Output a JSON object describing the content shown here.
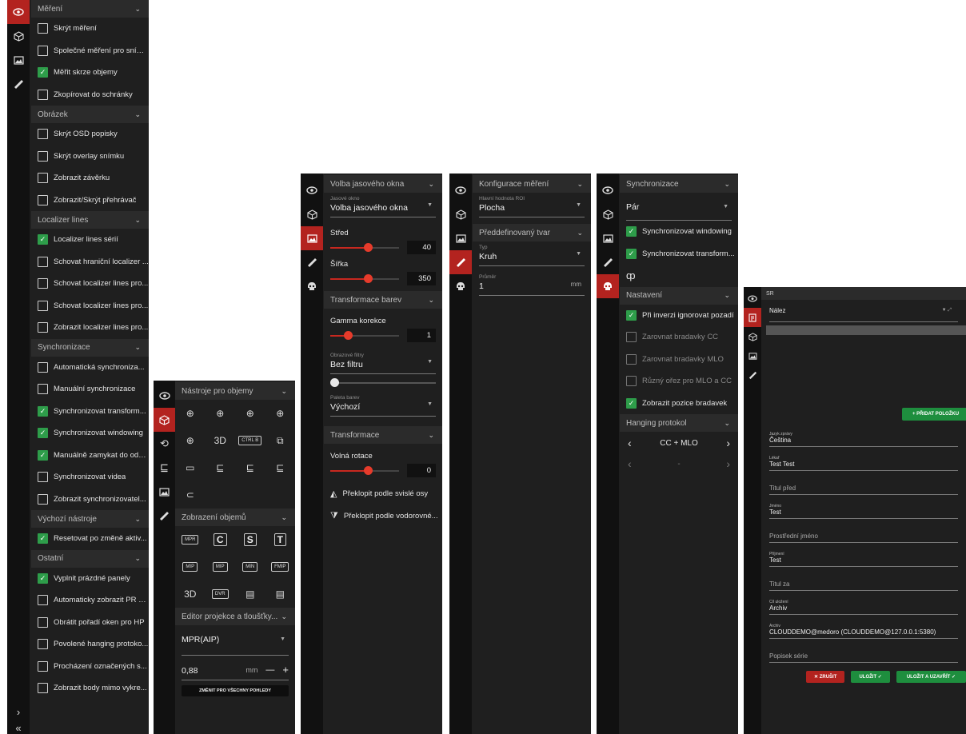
{
  "panel1": {
    "rail_icons": [
      "eye-icon",
      "cube-icon",
      "image-icon",
      "ruler-icon"
    ],
    "rail_bottom": [
      "›",
      "«"
    ],
    "sections": [
      {
        "title": "Měření",
        "items": [
          {
            "label": "Skrýt měření",
            "checked": false
          },
          {
            "label": "Společné měření pro sním...",
            "checked": false
          },
          {
            "label": "Měřit skrze objemy",
            "checked": true
          },
          {
            "label": "Zkopírovat do schránky",
            "checked": false
          }
        ]
      },
      {
        "title": "Obrázek",
        "items": [
          {
            "label": "Skrýt OSD popisky",
            "checked": false
          },
          {
            "label": "Skrýt overlay snímku",
            "checked": false
          },
          {
            "label": "Zobrazit závěrku",
            "checked": false
          },
          {
            "label": "Zobrazit/Skrýt přehrávač",
            "checked": false
          }
        ]
      },
      {
        "title": "Localizer lines",
        "items": [
          {
            "label": "Localizer lines sérií",
            "checked": true
          },
          {
            "label": "Schovat hraniční localizer ...",
            "checked": false
          },
          {
            "label": "Schovat localizer lines pro...",
            "checked": false
          },
          {
            "label": "Schovat localizer lines pro...",
            "checked": false
          },
          {
            "label": "Zobrazit localizer lines pro...",
            "checked": false
          }
        ]
      },
      {
        "title": "Synchronizace",
        "items": [
          {
            "label": "Automatická synchroniza...",
            "checked": false
          },
          {
            "label": "Manuální synchronizace",
            "checked": false
          },
          {
            "label": "Synchronizovat transform...",
            "checked": true
          },
          {
            "label": "Synchronizovat windowing",
            "checked": true
          },
          {
            "label": "Manuálně zamykat do odd...",
            "checked": true
          },
          {
            "label": "Synchronizovat videa",
            "checked": false
          },
          {
            "label": "Zobrazit synchronizovatel...",
            "checked": false
          }
        ]
      },
      {
        "title": "Výchozí nástroje",
        "items": [
          {
            "label": "Resetovat po změně aktiv...",
            "checked": true
          }
        ]
      },
      {
        "title": "Ostatní",
        "items": [
          {
            "label": "Vyplnit prázdné panely",
            "checked": true
          },
          {
            "label": "Automaticky zobrazit PR p...",
            "checked": false
          },
          {
            "label": "Obrátit pořadí oken pro HP",
            "checked": false
          },
          {
            "label": "Povolené hanging protoko...",
            "checked": false
          },
          {
            "label": "Procházení označených s...",
            "checked": false
          },
          {
            "label": "Zobrazit body mimo vykre...",
            "checked": false
          }
        ]
      }
    ]
  },
  "panel2": {
    "rail_icons": [
      "eye-icon",
      "cube-icon",
      "rotate-icon",
      "mpr-icon",
      "image-icon",
      "ruler-icon"
    ],
    "section1": "Nástroje pro objemy",
    "tools1": [
      "⊕",
      "⊕",
      "⊕",
      "⊕",
      "⊕",
      "3D",
      "CTRL B",
      "⧉",
      "▭",
      "⊑",
      "⊑",
      "⊑",
      "⊂"
    ],
    "section2": "Zobrazení objemů",
    "tools2": [
      "MPR",
      "C",
      "S",
      "T",
      "MIP",
      "MIP",
      "MIN",
      "FMIP",
      "3D",
      "DVR",
      "▤",
      "▤"
    ],
    "section3": "Editor projekce a tloušťky...",
    "mode": "MPR(AIP)",
    "thickness": "0,88",
    "unit": "mm",
    "minus": "—",
    "plus": "+",
    "apply_all": "ZMĚNIT PRO VŠECHNY POHLEDY"
  },
  "panel3": {
    "rail_icons": [
      "eye-icon",
      "cube-icon",
      "image-icon",
      "ruler-icon",
      "skull-icon"
    ],
    "section1": "Volba jasového okna",
    "window_label": "Jasové okno",
    "window_value": "Volba jasového okna",
    "center_label": "Střed",
    "center_value": "40",
    "center_level": 0.55,
    "width_label": "Šířka",
    "width_value": "350",
    "width_level": 0.55,
    "section2": "Transformace barev",
    "gamma_label": "Gamma korekce",
    "gamma_value": "1",
    "gamma_level": 0.25,
    "filter_label": "Obrazové filtry",
    "filter_value": "Bez filtru",
    "palette_label": "Paleta barev",
    "palette_value": "Výchozí",
    "section3": "Transformace",
    "rotation_label": "Volná rotace",
    "rotation_value": "0",
    "rotation_level": 0.55,
    "flip_v": "Překlopit podle svislé osy",
    "flip_h": "Překlopit podle vodorovné..."
  },
  "panel4": {
    "rail_icons": [
      "eye-icon",
      "cube-icon",
      "image-icon",
      "ruler-icon",
      "skull-icon"
    ],
    "section1": "Konfigurace měření",
    "roi_label": "Hlavní hodnota ROI",
    "roi_value": "Plocha",
    "section2": "Předdefinovaný tvar",
    "type_label": "Typ",
    "type_value": "Kruh",
    "diameter_label": "Průměr",
    "diameter_value": "1",
    "diameter_unit": "mm"
  },
  "panel5": {
    "rail_icons": [
      "eye-icon",
      "cube-icon",
      "image-icon",
      "ruler-icon",
      "skull-icon"
    ],
    "section1": "Synchronizace",
    "pair_value": "Pár",
    "sync_items": [
      {
        "label": "Synchronizovat windowing",
        "checked": true
      },
      {
        "label": "Synchronizovat transform...",
        "checked": true
      }
    ],
    "section2": "Nastavení",
    "settings": [
      {
        "label": "Při inverzi ignorovat pozadí",
        "checked": true,
        "disabled": false
      },
      {
        "label": "Zarovnat bradavky CC",
        "checked": false,
        "disabled": true
      },
      {
        "label": "Zarovnat bradavky MLO",
        "checked": false,
        "disabled": true
      },
      {
        "label": "Různý ořez pro MLO a CC",
        "checked": false,
        "disabled": true
      },
      {
        "label": "Zobrazit pozice bradavek",
        "checked": true,
        "disabled": false
      }
    ],
    "section3": "Hanging protokol",
    "protocol_value": "CC + MLO",
    "protocol_value2": "-"
  },
  "panel6": {
    "rail_icons": [
      "eye-icon",
      "report-icon",
      "cube-icon",
      "image-icon",
      "ruler-icon"
    ],
    "title": "SR",
    "finding_value": "Nález",
    "add_item": "+ PŘIDAT POLOŽKU",
    "fields": [
      {
        "label": "Jazyk zprávy",
        "value": "Čeština"
      },
      {
        "label": "Lékař",
        "value": "Test Test"
      },
      {
        "label": "",
        "value": "Titul před",
        "placeholder": true
      },
      {
        "label": "Jméno",
        "value": "Test"
      },
      {
        "label": "",
        "value": "Prostřední jméno",
        "placeholder": true
      },
      {
        "label": "Příjmení",
        "value": "Test"
      },
      {
        "label": "",
        "value": "Titul za",
        "placeholder": true
      },
      {
        "label": "Cíl uložení",
        "value": "Archiv"
      },
      {
        "label": "Archiv",
        "value": "CLOUDDEMO@medoro (CLOUDDEMO@127.0.0.1:5380)"
      },
      {
        "label": "",
        "value": "Popisek série",
        "placeholder": true
      }
    ],
    "cancel": "✕ ZRUŠIT",
    "save": "ULOŽIT ✓",
    "save_close": "ULOŽIT A UZAVŘÍT ✓",
    "colors": {
      "accent": "#b3231f",
      "green": "#1e8e3e"
    }
  }
}
